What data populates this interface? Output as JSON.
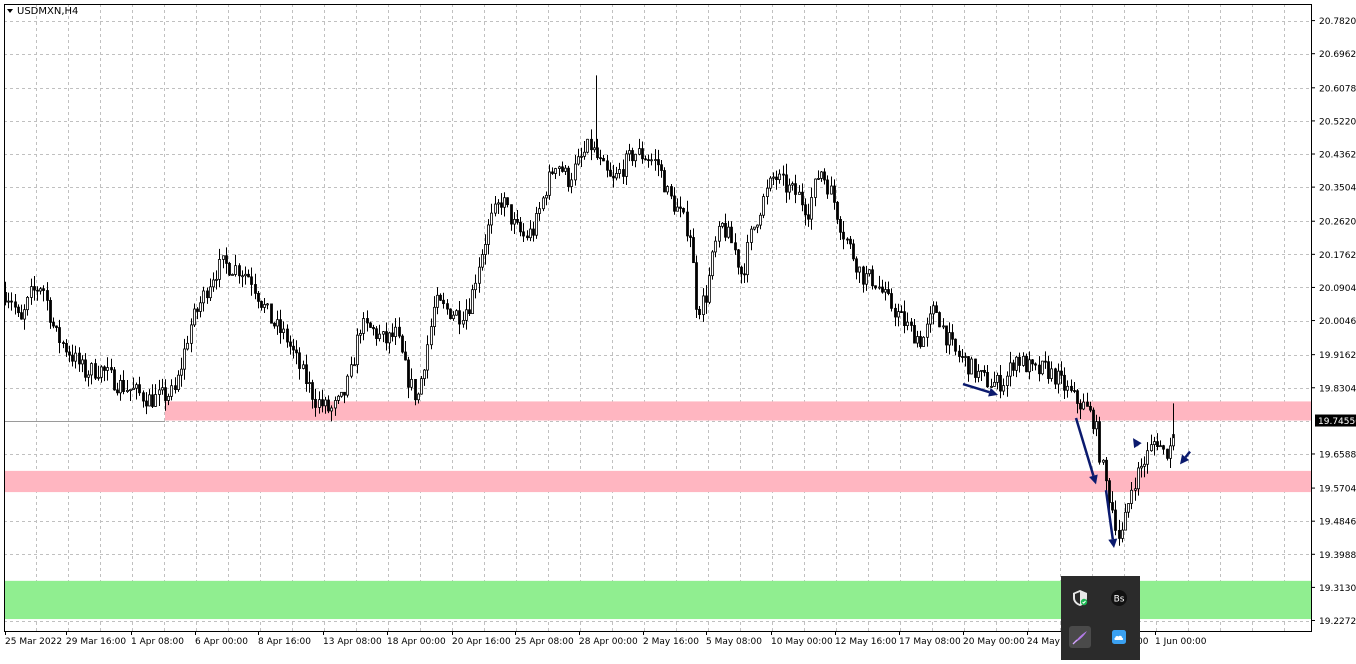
{
  "window": {
    "symbol_title": "USDMXN,H4"
  },
  "chart_data": {
    "type": "candlestick",
    "symbol": "USDMXN",
    "timeframe": "H4",
    "ylim": [
      19.2,
      20.825
    ],
    "y_ticks": [
      20.782,
      20.6962,
      20.6078,
      20.522,
      20.4362,
      20.3504,
      20.262,
      20.1762,
      20.0904,
      20.0046,
      19.9162,
      19.8304,
      19.7455,
      19.6588,
      19.5704,
      19.4846,
      19.3988,
      19.313,
      19.2272
    ],
    "y_tick_labels": [
      "20.78200",
      "20.69620",
      "20.60780",
      "20.52200",
      "20.43620",
      "20.35040",
      "20.26200",
      "20.17620",
      "20.09040",
      "20.00460",
      "19.91620",
      "19.83040",
      "19.74550",
      "19.65880",
      "19.57040",
      "19.48460",
      "19.39880",
      "19.31300",
      "19.22720"
    ],
    "x_tick_labels": [
      "25 Mar 2022",
      "29 Mar 16:00",
      "1 Apr 08:00",
      "6 Apr 00:00",
      "8 Apr 16:00",
      "13 Apr 08:00",
      "18 Apr 00:00",
      "20 Apr 16:00",
      "25 Apr 08:00",
      "28 Apr 00:00",
      "2 May 16:00",
      "5 May 08:00",
      "10 May 00:00",
      "12 May 16:00",
      "17 May 08:00",
      "20 May 00:00",
      "24 May",
      "00",
      "1 Jun 00:00"
    ],
    "current_price": 19.7455,
    "current_price_label": "19.74550",
    "grid": true,
    "zones": [
      {
        "from": 19.7455,
        "to": 19.795,
        "color": "#ffb6c1",
        "start_date": "1 Apr 08:00"
      },
      {
        "from": 19.56,
        "to": 19.615,
        "color": "#ffb6c1",
        "start_date": "25 Mar 2022"
      },
      {
        "from": 19.231,
        "to": 19.33,
        "color": "#90ee90",
        "start_date": "25 Mar 2022"
      }
    ],
    "waypoints": [
      [
        0,
        20.09
      ],
      [
        12,
        20.06
      ],
      [
        20,
        19.99
      ],
      [
        30,
        20.07
      ],
      [
        42,
        20.1
      ],
      [
        55,
        19.97
      ],
      [
        70,
        19.92
      ],
      [
        85,
        19.87
      ],
      [
        100,
        19.88
      ],
      [
        118,
        19.84
      ],
      [
        135,
        19.82
      ],
      [
        150,
        19.8
      ],
      [
        165,
        19.81
      ],
      [
        175,
        19.82
      ],
      [
        190,
        19.99
      ],
      [
        202,
        20.06
      ],
      [
        212,
        20.12
      ],
      [
        222,
        20.15
      ],
      [
        238,
        20.14
      ],
      [
        250,
        20.12
      ],
      [
        260,
        20.06
      ],
      [
        272,
        20.0
      ],
      [
        286,
        19.96
      ],
      [
        300,
        19.88
      ],
      [
        315,
        19.8
      ],
      [
        330,
        19.77
      ],
      [
        342,
        19.8
      ],
      [
        350,
        19.86
      ],
      [
        360,
        19.99
      ],
      [
        372,
        19.98
      ],
      [
        385,
        19.95
      ],
      [
        396,
        19.97
      ],
      [
        407,
        19.86
      ],
      [
        417,
        19.8
      ],
      [
        425,
        19.91
      ],
      [
        435,
        20.05
      ],
      [
        448,
        20.03
      ],
      [
        460,
        20.02
      ],
      [
        470,
        20.05
      ],
      [
        478,
        20.15
      ],
      [
        490,
        20.26
      ],
      [
        502,
        20.32
      ],
      [
        514,
        20.25
      ],
      [
        524,
        20.22
      ],
      [
        534,
        20.24
      ],
      [
        546,
        20.35
      ],
      [
        556,
        20.42
      ],
      [
        568,
        20.37
      ],
      [
        580,
        20.42
      ],
      [
        590,
        20.46
      ],
      [
        600,
        20.41
      ],
      [
        612,
        20.36
      ],
      [
        622,
        20.4
      ],
      [
        634,
        20.44
      ],
      [
        646,
        20.43
      ],
      [
        658,
        20.41
      ],
      [
        668,
        20.33
      ],
      [
        680,
        20.28
      ],
      [
        690,
        20.23
      ],
      [
        697,
        20.03
      ],
      [
        706,
        20.07
      ],
      [
        714,
        20.19
      ],
      [
        722,
        20.25
      ],
      [
        733,
        20.2
      ],
      [
        742,
        20.12
      ],
      [
        750,
        20.22
      ],
      [
        762,
        20.31
      ],
      [
        774,
        20.38
      ],
      [
        786,
        20.35
      ],
      [
        798,
        20.33
      ],
      [
        808,
        20.29
      ],
      [
        820,
        20.4
      ],
      [
        832,
        20.33
      ],
      [
        842,
        20.24
      ],
      [
        852,
        20.18
      ],
      [
        862,
        20.12
      ],
      [
        874,
        20.11
      ],
      [
        886,
        20.06
      ],
      [
        898,
        20.02
      ],
      [
        910,
        19.98
      ],
      [
        922,
        19.95
      ],
      [
        935,
        20.04
      ],
      [
        945,
        19.97
      ],
      [
        955,
        19.92
      ],
      [
        965,
        19.9
      ],
      [
        975,
        19.87
      ],
      [
        985,
        19.85
      ],
      [
        995,
        19.84
      ],
      [
        1005,
        19.85
      ],
      [
        1015,
        19.91
      ],
      [
        1025,
        19.89
      ],
      [
        1035,
        19.87
      ],
      [
        1045,
        19.88
      ],
      [
        1055,
        19.86
      ],
      [
        1065,
        19.83
      ],
      [
        1075,
        19.8
      ],
      [
        1085,
        19.78
      ],
      [
        1095,
        19.74
      ],
      [
        1100,
        19.65
      ],
      [
        1106,
        19.58
      ],
      [
        1114,
        19.5
      ],
      [
        1120,
        19.43
      ],
      [
        1126,
        19.5
      ],
      [
        1132,
        19.58
      ],
      [
        1140,
        19.62
      ],
      [
        1148,
        19.66
      ],
      [
        1156,
        19.7
      ],
      [
        1164,
        19.66
      ],
      [
        1171,
        19.68
      ],
      [
        1174,
        19.7455
      ]
    ]
  },
  "annotations": {
    "arrows": [
      {
        "from": [
          "19 May 12:00",
          19.84
        ],
        "to": [
          "20 May 00:00",
          19.81
        ],
        "color": "#0b1a6e"
      },
      {
        "from": [
          "26 May 12:00",
          19.75
        ],
        "to": [
          "27 May 04:00",
          19.57
        ],
        "color": "#0b1a6e"
      },
      {
        "from": [
          "27 May 12:00",
          19.56
        ],
        "to": [
          "27 May 20:00",
          19.415
        ],
        "color": "#0b1a6e"
      },
      {
        "from": [
          "31 May 00:00",
          19.68
        ],
        "to": [
          "30 May 16:00",
          19.7
        ],
        "color": "#0b1a6e"
      },
      {
        "from": [
          "1 Jun 04:00",
          19.665
        ],
        "to": [
          "1 Jun 00:00",
          19.63
        ],
        "color": "#0b1a6e"
      }
    ]
  },
  "colors": {
    "background": "#ffffff",
    "grid": "#c0c0c0",
    "candle": "#000000",
    "price_tag_bg": "#000000",
    "price_tag_text": "#ffffff"
  },
  "taskbar_tray": {
    "icons": [
      "shield-check-icon",
      "app-bs-icon",
      "feather-icon",
      "cloud-icon"
    ]
  }
}
